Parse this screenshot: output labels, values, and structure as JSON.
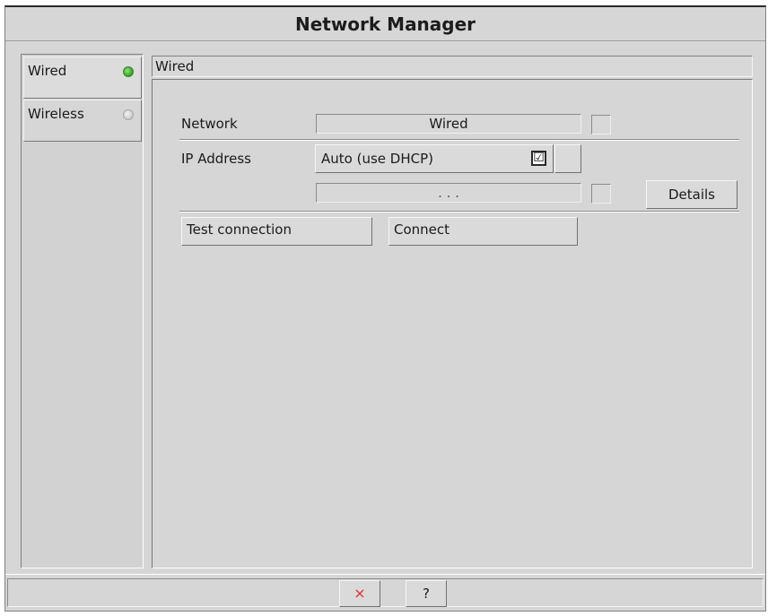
{
  "window": {
    "title": "Network Manager"
  },
  "sidebar": {
    "items": [
      {
        "label": "Wired",
        "status": "connected",
        "status_color": "#3aa82a"
      },
      {
        "label": "Wireless",
        "status": "disconnected",
        "status_color": "#cfcfcf"
      }
    ]
  },
  "panel": {
    "header": "Wired",
    "network": {
      "label": "Network",
      "value": "Wired"
    },
    "ip": {
      "label": "IP Address",
      "mode": "Auto (use DHCP)",
      "checked": true,
      "check_glyph": "☑",
      "address_value": ". . ."
    },
    "details_label": "Details",
    "test_label": "Test connection",
    "connect_label": "Connect"
  },
  "statusbar": {
    "close_glyph": "×",
    "help_glyph": "?"
  },
  "colors": {
    "background": "#d6d6d6",
    "close": "#e03030"
  }
}
